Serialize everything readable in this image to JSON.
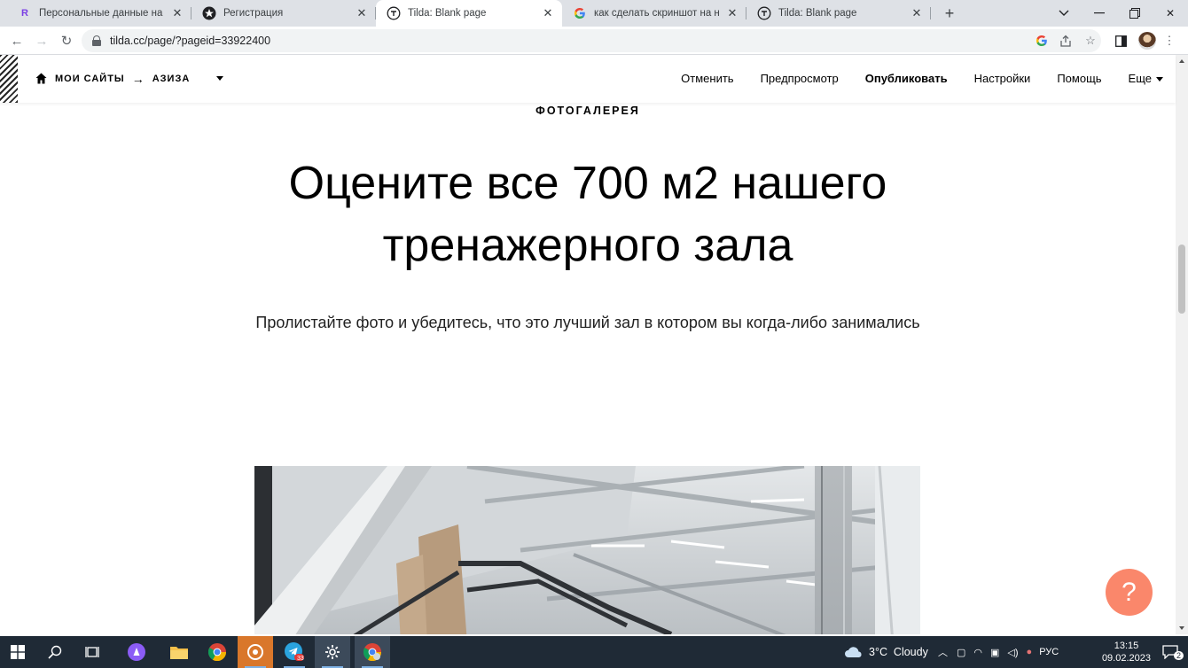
{
  "browser": {
    "tabs": [
      {
        "title": "Персональные данные на Freela",
        "favicon": "freelance-r-icon",
        "active": false
      },
      {
        "title": "Регистрация",
        "favicon": "star-badge-icon",
        "active": false
      },
      {
        "title": "Tilda: Blank page",
        "favicon": "tilda-icon",
        "active": true
      },
      {
        "title": "как сделать скриншот на ноутбу",
        "favicon": "google-icon",
        "active": false
      },
      {
        "title": "Tilda: Blank page",
        "favicon": "tilda-icon",
        "active": false
      }
    ],
    "url": "tilda.cc/page/?pageid=33922400"
  },
  "tilda": {
    "breadcrumb": {
      "sites": "МОИ САЙТЫ",
      "arrow": "→",
      "project": "АЗИЗА"
    },
    "menu": {
      "cancel": "Отменить",
      "preview": "Предпросмотр",
      "publish": "Опубликовать",
      "settings": "Настройки",
      "help": "Помощь",
      "more": "Еще"
    },
    "help_button": "?"
  },
  "content": {
    "kicker": "ФОТОГАЛЕРЕЯ",
    "headline": "Оцените все 700 м2 нашего тренажерного зала",
    "subhead": "Пролистайте фото и убедитесь, что это лучший зал в котором вы когда-либо занимались"
  },
  "taskbar": {
    "weather": "3°C  Cloudy",
    "lang": "РУС",
    "time": "13:15",
    "date": "09.02.2023",
    "notifications": "2",
    "telegram_badge": "33"
  },
  "colors": {
    "accent_help": "#fa876b",
    "taskbar": "#1f2a36"
  }
}
